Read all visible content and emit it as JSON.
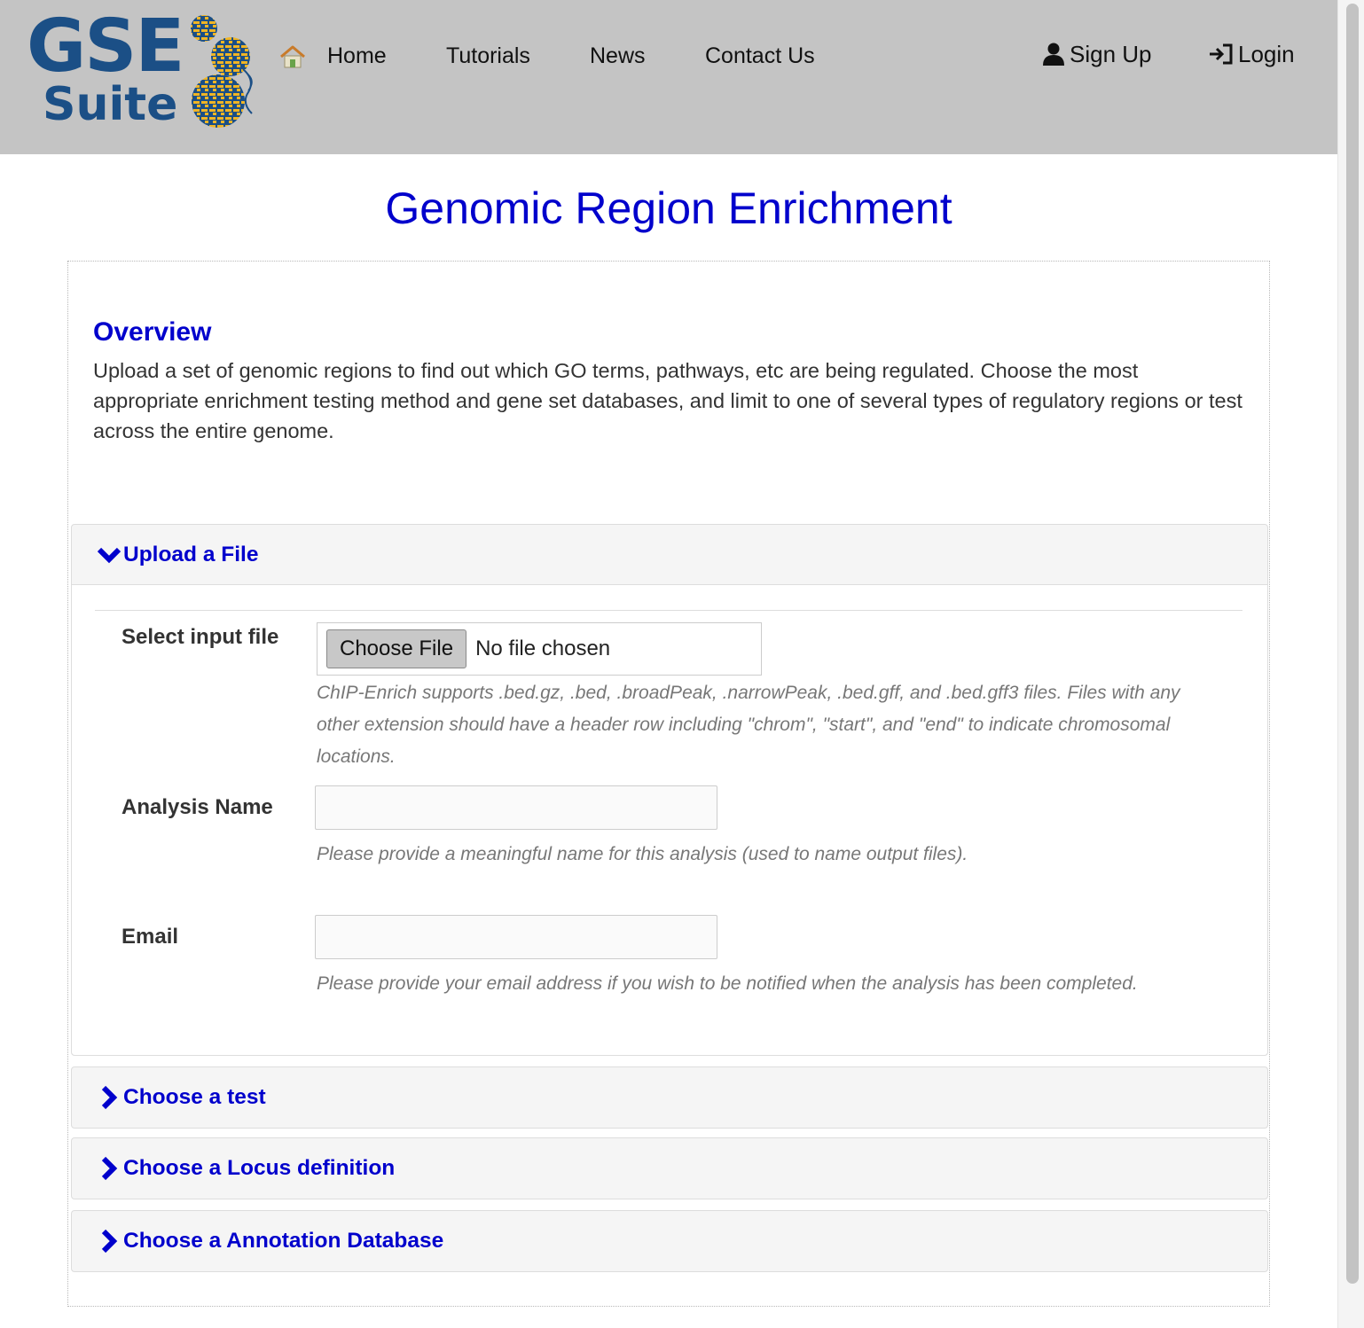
{
  "brand": {
    "logo_line1": "GSE",
    "logo_line2": "Suite",
    "colors": {
      "blue": "#1b4f86",
      "gold": "#f1b524",
      "navbar": "#c4c4c4",
      "link": "#0000cc"
    }
  },
  "nav": {
    "home_icon": "home-icon",
    "links": [
      "Home",
      "Tutorials",
      "News",
      "Contact Us"
    ],
    "signup_label": "Sign Up",
    "signup_icon": "user-icon",
    "login_label": "Login",
    "login_icon": "login-icon"
  },
  "page": {
    "title": "Genomic Region Enrichment"
  },
  "overview": {
    "title": "Overview",
    "text": "Upload a set of genomic regions to find out which GO terms, pathways, etc are being regulated. Choose the most appropriate enrichment testing method and gene set databases, and limit to one of several types of regulatory regions or test across the entire genome."
  },
  "upload_panel": {
    "title": "Upload a File",
    "chevron_icon": "chevron-down-icon",
    "file_field": {
      "label": "Select input file",
      "button_label": "Choose File",
      "status": "No file chosen",
      "help": "ChIP-Enrich supports .bed.gz, .bed, .broadPeak, .narrowPeak, .bed.gff, and .bed.gff3 files. Files with any other extension should have a header row including \"chrom\", \"start\", and \"end\" to indicate chromosomal locations."
    },
    "name_field": {
      "label": "Analysis Name",
      "value": "",
      "help": "Please provide a meaningful name for this analysis (used to name output files)."
    },
    "email_field": {
      "label": "Email",
      "value": "",
      "help": "Please provide your email address if you wish to be notified when the analysis has been completed."
    }
  },
  "collapsed_panels": [
    {
      "title": "Choose a test",
      "chevron_icon": "chevron-right-icon"
    },
    {
      "title": "Choose a Locus definition",
      "chevron_icon": "chevron-right-icon"
    },
    {
      "title": "Choose a Annotation Database",
      "chevron_icon": "chevron-right-icon"
    }
  ]
}
